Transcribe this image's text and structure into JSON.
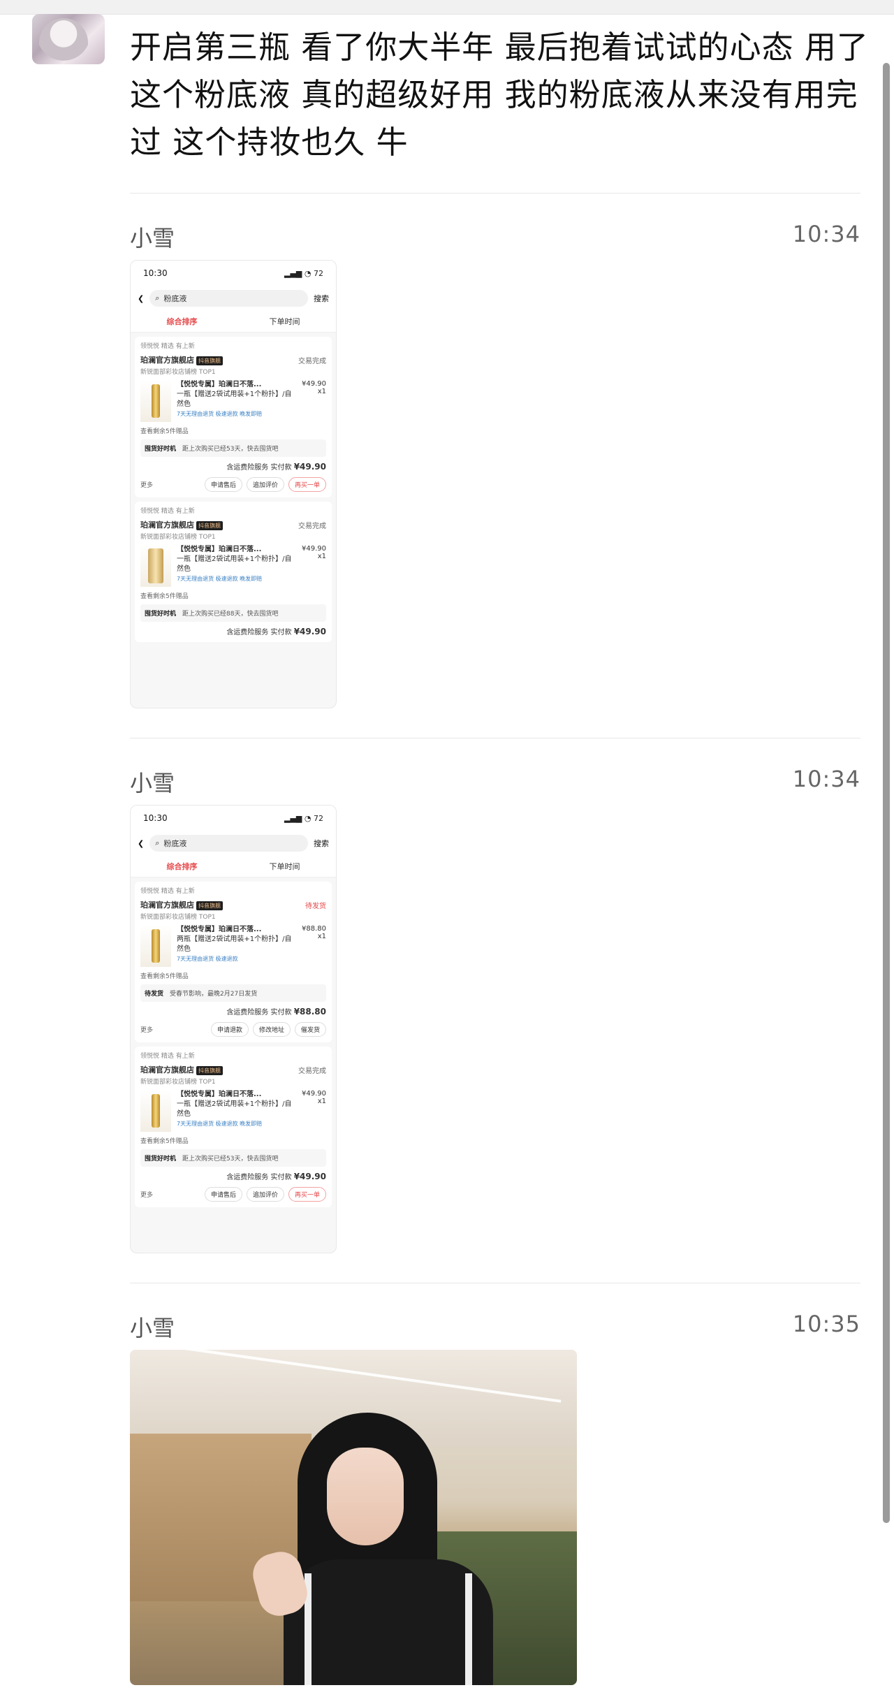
{
  "post": {
    "text": "开启第三瓶 看了你大半年 最后抱着试试的心态 用了这个粉底液 真的超级好用 我的粉底液从来没有用完过 这个持妆也久 牛"
  },
  "messages": [
    {
      "sender": "小雪",
      "time": "10:34",
      "screenshot": {
        "status_time": "10:30",
        "battery": "72",
        "search_text": "粉底液",
        "search_button": "搜索",
        "tab_left": "综合排序",
        "tab_right": "下单时间",
        "orders": [
          {
            "tags": "领悦悦 精选 有上新",
            "shop": "珀澜官方旗舰店",
            "badge": "抖音旗舰",
            "rank": "新锐面部彩妆店铺榜 TOP1",
            "status": "交易完成",
            "name": "【悦悦专属】珀澜日不落...",
            "desc": "一瓶【赠送2袋试用装+1个粉扑】/自然色",
            "price": "¥49.90",
            "qty": "x1",
            "service": "7天无理由退货 极速退款 晚发即赔",
            "more": "查看剩余5件赠品",
            "notice_title": "囤货好时机",
            "notice_text": "距上次购买已经53天，快去囤货吧",
            "total_label": "含运费险服务 实付款",
            "total": "¥49.90",
            "side": "更多",
            "buttons": [
              "申请售后",
              "追加评价",
              "再买一单"
            ]
          },
          {
            "tags": "领悦悦 精选 有上新",
            "shop": "珀澜官方旗舰店",
            "badge": "抖音旗舰",
            "rank": "新锐面部彩妆店铺榜 TOP1",
            "status": "交易完成",
            "name": "【悦悦专属】珀澜日不落...",
            "desc": "一瓶【赠送2袋试用装+1个粉扑】/自然色",
            "price": "¥49.90",
            "qty": "x1",
            "service": "7天无理由退货 极速退款 晚发即赔",
            "more": "查看剩余5件赠品",
            "notice_title": "囤货好时机",
            "notice_text": "距上次购买已经88天，快去囤货吧",
            "total_label": "含运费险服务 实付款",
            "total": "¥49.90"
          }
        ]
      }
    },
    {
      "sender": "小雪",
      "time": "10:34",
      "screenshot": {
        "status_time": "10:30",
        "battery": "72",
        "search_text": "粉底液",
        "search_button": "搜索",
        "tab_left": "综合排序",
        "tab_right": "下单时间",
        "orders": [
          {
            "tags": "领悦悦 精选 有上新",
            "shop": "珀澜官方旗舰店",
            "badge": "抖音旗舰",
            "rank": "新锐面部彩妆店铺榜 TOP1",
            "status": "待发货",
            "name": "【悦悦专属】珀澜日不落...",
            "desc": "两瓶【赠送2袋试用装+1个粉扑】/自然色",
            "price": "¥88.80",
            "qty": "x1",
            "service": "7天无理由退货 极速退款",
            "more": "查看剩余5件赠品",
            "notice_title": "待发货",
            "notice_text": "受春节影响，最晚2月27日发货",
            "total_label": "含运费险服务 实付款",
            "total": "¥88.80",
            "side": "更多",
            "buttons": [
              "申请退款",
              "修改地址",
              "催发货"
            ]
          },
          {
            "tags": "领悦悦 精选 有上新",
            "shop": "珀澜官方旗舰店",
            "badge": "抖音旗舰",
            "rank": "新锐面部彩妆店铺榜 TOP1",
            "status": "交易完成",
            "name": "【悦悦专属】珀澜日不落...",
            "desc": "一瓶【赠送2袋试用装+1个粉扑】/自然色",
            "price": "¥49.90",
            "qty": "x1",
            "service": "7天无理由退货 极速退款 晚发即赔",
            "more": "查看剩余5件赠品",
            "notice_title": "囤货好时机",
            "notice_text": "距上次购买已经53天，快去囤货吧",
            "total_label": "含运费险服务 实付款",
            "total": "¥49.90",
            "side": "更多",
            "buttons": [
              "申请售后",
              "追加评价",
              "再买一单"
            ]
          }
        ]
      }
    },
    {
      "sender": "小雪",
      "time": "10:35"
    }
  ],
  "colors": {
    "accent_red": "#e6484a",
    "divider": "#e7e7e7"
  }
}
